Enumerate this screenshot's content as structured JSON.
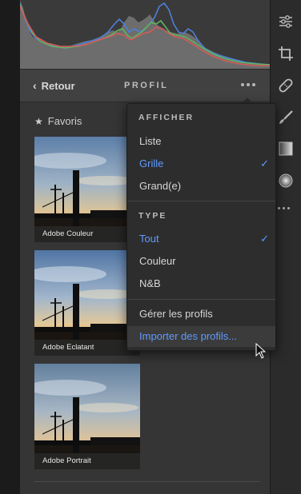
{
  "header": {
    "back_label": "Retour",
    "title": "PROFIL"
  },
  "favorites": {
    "label": "Favoris"
  },
  "profiles": [
    {
      "label": "Adobe Couleur"
    },
    {
      "label": "Adobe Eclatant"
    },
    {
      "label": "Adobe Portrait"
    }
  ],
  "menu": {
    "section_afficher": "AFFICHER",
    "afficher_items": [
      {
        "label": "Liste",
        "selected": false
      },
      {
        "label": "Grille",
        "selected": true
      },
      {
        "label": "Grand(e)",
        "selected": false
      }
    ],
    "section_type": "TYPE",
    "type_items": [
      {
        "label": "Tout",
        "selected": true
      },
      {
        "label": "Couleur",
        "selected": false
      },
      {
        "label": "N&B",
        "selected": false
      }
    ],
    "manage_label": "Gérer les profils",
    "import_label": "Importer des profils..."
  },
  "rail_icons": [
    "sliders-icon",
    "crop-icon",
    "healing-icon",
    "brush-icon",
    "gradient-icon",
    "radial-icon",
    "more-icon"
  ],
  "colors": {
    "accent": "#5f9bff",
    "panel": "#353535",
    "menu": "#2d2d2d"
  }
}
